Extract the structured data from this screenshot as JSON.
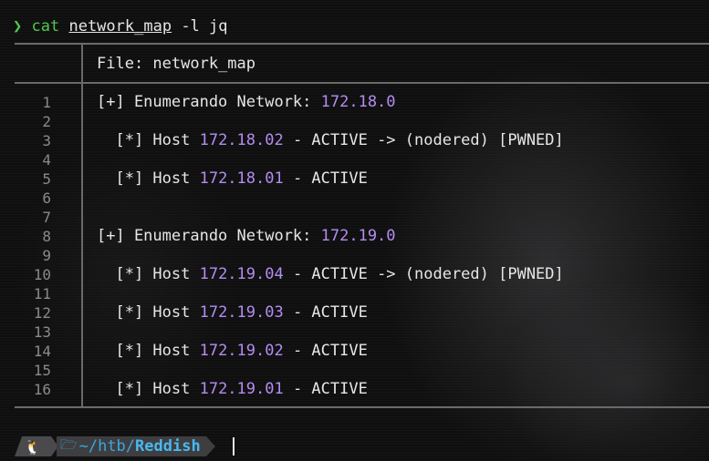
{
  "command": {
    "prompt_symbol": "❯",
    "name": "cat",
    "argument": "network_map",
    "flags": "-l jq"
  },
  "file_header": "File: network_map",
  "lines": [
    {
      "number": "1",
      "segments": [
        {
          "text": "[+] Enumerando Network: ",
          "kind": "text"
        },
        {
          "text": "172.18.0",
          "kind": "ip"
        }
      ]
    },
    {
      "number": "2",
      "segments": []
    },
    {
      "number": "3",
      "segments": [
        {
          "text": "  [*] Host ",
          "kind": "text"
        },
        {
          "text": "172.18.02",
          "kind": "ip"
        },
        {
          "text": " - ACTIVE -> (nodered) [PWNED]",
          "kind": "text"
        }
      ]
    },
    {
      "number": "4",
      "segments": []
    },
    {
      "number": "5",
      "segments": [
        {
          "text": "  [*] Host ",
          "kind": "text"
        },
        {
          "text": "172.18.01",
          "kind": "ip"
        },
        {
          "text": " - ACTIVE",
          "kind": "text"
        }
      ]
    },
    {
      "number": "6",
      "segments": []
    },
    {
      "number": "7",
      "segments": []
    },
    {
      "number": "8",
      "segments": [
        {
          "text": "[+] Enumerando Network: ",
          "kind": "text"
        },
        {
          "text": "172.19.0",
          "kind": "ip"
        }
      ]
    },
    {
      "number": "9",
      "segments": []
    },
    {
      "number": "10",
      "segments": [
        {
          "text": "  [*] Host ",
          "kind": "text"
        },
        {
          "text": "172.19.04",
          "kind": "ip"
        },
        {
          "text": " - ACTIVE -> (nodered) [PWNED]",
          "kind": "text"
        }
      ]
    },
    {
      "number": "11",
      "segments": []
    },
    {
      "number": "12",
      "segments": [
        {
          "text": "  [*] Host ",
          "kind": "text"
        },
        {
          "text": "172.19.03",
          "kind": "ip"
        },
        {
          "text": " - ACTIVE",
          "kind": "text"
        }
      ]
    },
    {
      "number": "13",
      "segments": []
    },
    {
      "number": "14",
      "segments": [
        {
          "text": "  [*] Host ",
          "kind": "text"
        },
        {
          "text": "172.19.02",
          "kind": "ip"
        },
        {
          "text": " - ACTIVE",
          "kind": "text"
        }
      ]
    },
    {
      "number": "15",
      "segments": []
    },
    {
      "number": "16",
      "segments": [
        {
          "text": "  [*] Host ",
          "kind": "text"
        },
        {
          "text": "172.19.01",
          "kind": "ip"
        },
        {
          "text": " - ACTIVE",
          "kind": "text"
        }
      ]
    }
  ],
  "statusbar": {
    "os_icon": "linux-tux-icon",
    "os_glyph": "🐧",
    "folder_icon": "folder-open-icon",
    "folder_glyph": "🗁",
    "path_prefix": "~/htb/",
    "path_leaf": "Reddish"
  },
  "colors": {
    "prompt_green": "#4ec94e",
    "ip_purple": "#b58cf0",
    "path_blue": "#3aa7e0",
    "separator_gray": "#6a6a6a",
    "line_number_gray": "#8a8a8a"
  }
}
